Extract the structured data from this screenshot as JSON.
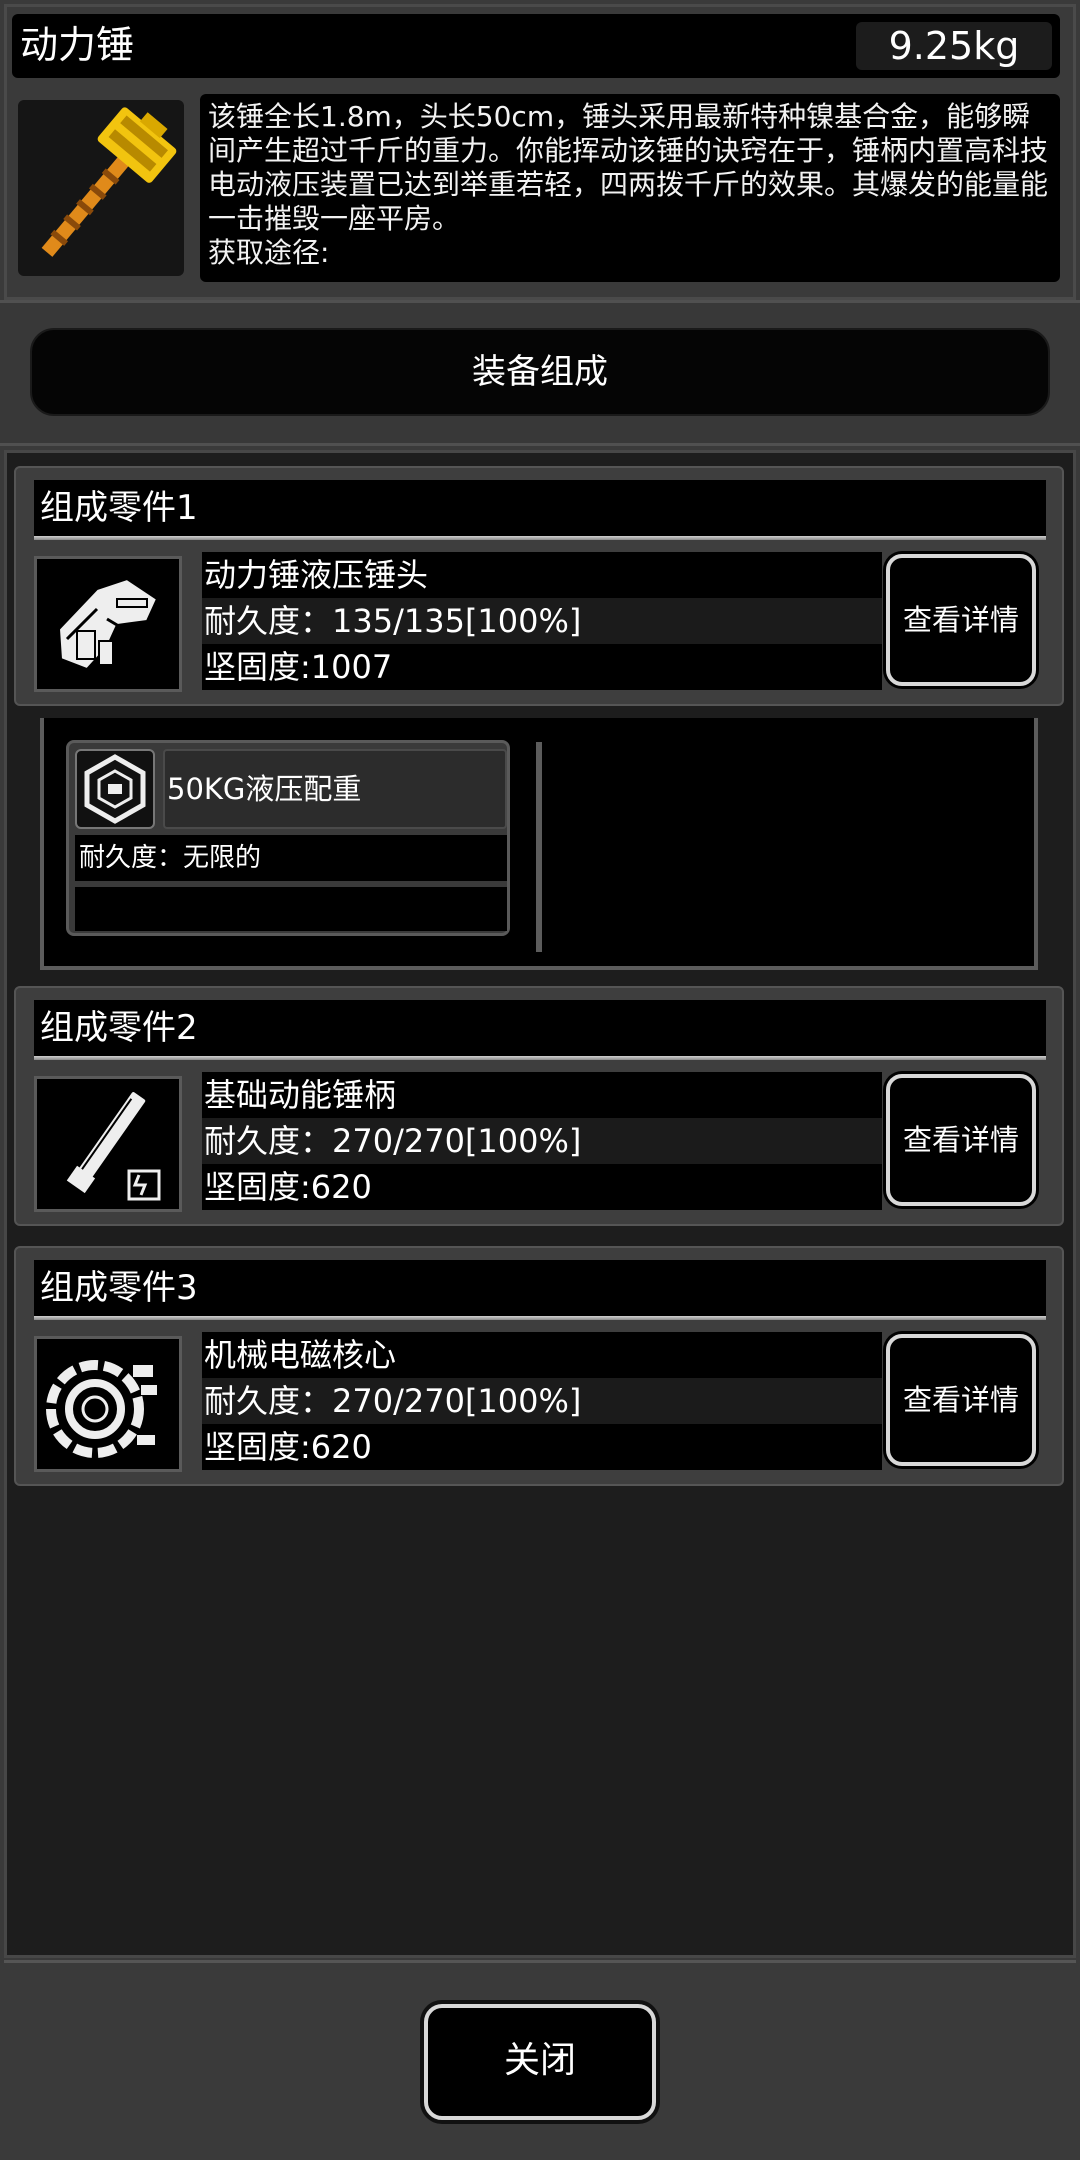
{
  "item": {
    "name": "动力锤",
    "weight": "9.25kg",
    "description": "该锤全长1.8m，头长50cm，锤头采用最新特种镍基合金，能够瞬间产生超过千斤的重力。你能挥动该锤的诀窍在于，锤柄内置高科技电动液压装置已达到举重若轻，四两拨千斤的效果。其爆发的能量能一击摧毁一座平房。",
    "source_label": "获取途径:",
    "icon": "power-hammer-icon"
  },
  "composition_button": "装备组成",
  "parts": [
    {
      "title": "组成零件1",
      "name": "动力锤液压锤头",
      "durability": "耐久度：135/135[100%]",
      "hardness": "坚固度:1007",
      "view_label": "查看详情",
      "icon": "hammer-head-icon"
    },
    {
      "title": "组成零件2",
      "name": "基础动能锤柄",
      "durability": "耐久度：270/270[100%]",
      "hardness": "坚固度:620",
      "view_label": "查看详情",
      "icon": "hammer-handle-icon"
    },
    {
      "title": "组成零件3",
      "name": "机械电磁核心",
      "durability": "耐久度：270/270[100%]",
      "hardness": "坚固度:620",
      "view_label": "查看详情",
      "icon": "electromagnetic-core-icon"
    }
  ],
  "sub_part": {
    "name": "50KG液压配重",
    "durability": "耐久度：无限的",
    "icon": "counterweight-icon"
  },
  "close_label": "关闭"
}
